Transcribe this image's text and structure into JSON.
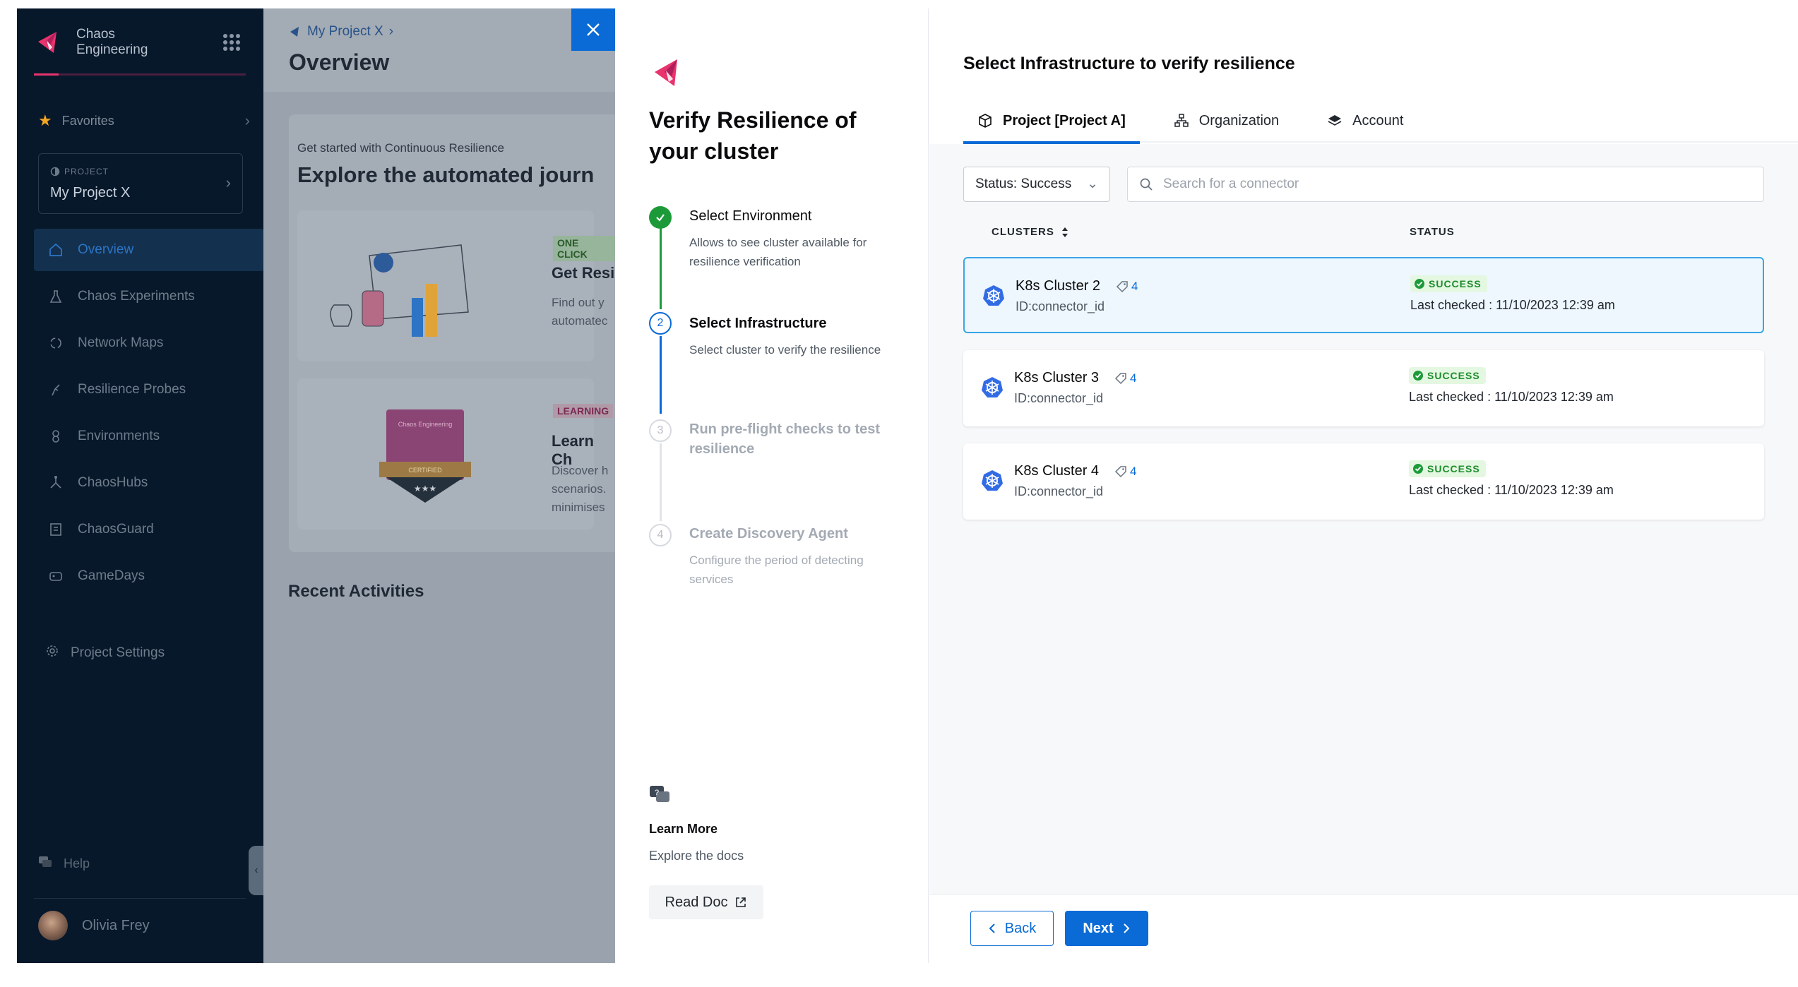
{
  "colors": {
    "accent": "#0a6ad6",
    "brand_pink": "#e8336d",
    "success": "#1c8d2c",
    "sidebar_bg": "#07182b"
  },
  "sidebar": {
    "brand": "Chaos Engineering",
    "favorites_label": "Favorites",
    "project": {
      "label": "PROJECT",
      "value": "My Project X"
    },
    "items": [
      {
        "label": "Overview",
        "icon": "home-icon",
        "active": true
      },
      {
        "label": "Chaos Experiments",
        "icon": "flask-icon"
      },
      {
        "label": "Network Maps",
        "icon": "network-icon"
      },
      {
        "label": "Resilience Probes",
        "icon": "probe-icon"
      },
      {
        "label": "Environments",
        "icon": "environment-icon"
      },
      {
        "label": "ChaosHubs",
        "icon": "hub-icon"
      },
      {
        "label": "ChaosGuard",
        "icon": "guard-icon"
      },
      {
        "label": "GameDays",
        "icon": "gameday-icon"
      }
    ],
    "settings_label": "Project Settings",
    "help_label": "Help",
    "user_name": "Olivia Frey"
  },
  "main": {
    "breadcrumb": "My Project X",
    "title": "Overview",
    "card_subtitle": "Get started with Continuous Resilience",
    "card_title": "Explore the automated journ",
    "tile1": {
      "badge": "ONE CLICK",
      "title": "Get Resi",
      "desc": "Find out y automatec"
    },
    "tile2": {
      "badge": "LEARNING",
      "title": "Learn Ch",
      "desc": "Discover h scenarios. minimises",
      "cert_top": "Chaos Engineering",
      "cert_mid": "CERTIFIED"
    },
    "recent": "Recent Activities"
  },
  "wizard": {
    "title": "Verify Resilience of your cluster",
    "steps": [
      {
        "num": "1",
        "title": "Select Environment",
        "desc": "Allows to see cluster available for resilience verification",
        "state": "done"
      },
      {
        "num": "2",
        "title": "Select Infrastructure",
        "desc": "Select cluster to verify the resilience",
        "state": "active"
      },
      {
        "num": "3",
        "title": "Run pre-flight checks to test resilience",
        "desc": "",
        "state": "pending"
      },
      {
        "num": "4",
        "title": "Create Discovery Agent",
        "desc": "Configure the period of detecting services",
        "state": "pending"
      }
    ],
    "learn_title": "Learn More",
    "learn_desc": "Explore the docs",
    "read_doc": "Read Doc"
  },
  "panel": {
    "title": "Select Infrastructure to verify resilience",
    "tabs": [
      {
        "label": "Project [Project A]",
        "icon": "cube-icon",
        "active": true
      },
      {
        "label": "Organization",
        "icon": "org-icon"
      },
      {
        "label": "Account",
        "icon": "layers-icon"
      }
    ],
    "filter_label": "Status: Success",
    "search_placeholder": "Search for a connector",
    "columns": {
      "clusters": "CLUSTERS",
      "status": "STATUS"
    },
    "rows": [
      {
        "name": "K8s Cluster 2",
        "tags": "4",
        "id": "ID:connector_id",
        "status": "SUCCESS",
        "checked": "Last checked : 11/10/2023 12:39 am",
        "selected": true
      },
      {
        "name": "K8s Cluster 3",
        "tags": "4",
        "id": "ID:connector_id",
        "status": "SUCCESS",
        "checked": "Last checked : 11/10/2023 12:39 am",
        "selected": false
      },
      {
        "name": "K8s Cluster 4",
        "tags": "4",
        "id": "ID:connector_id",
        "status": "SUCCESS",
        "checked": "Last checked : 11/10/2023 12:39 am",
        "selected": false
      }
    ],
    "back": "Back",
    "next": "Next"
  }
}
